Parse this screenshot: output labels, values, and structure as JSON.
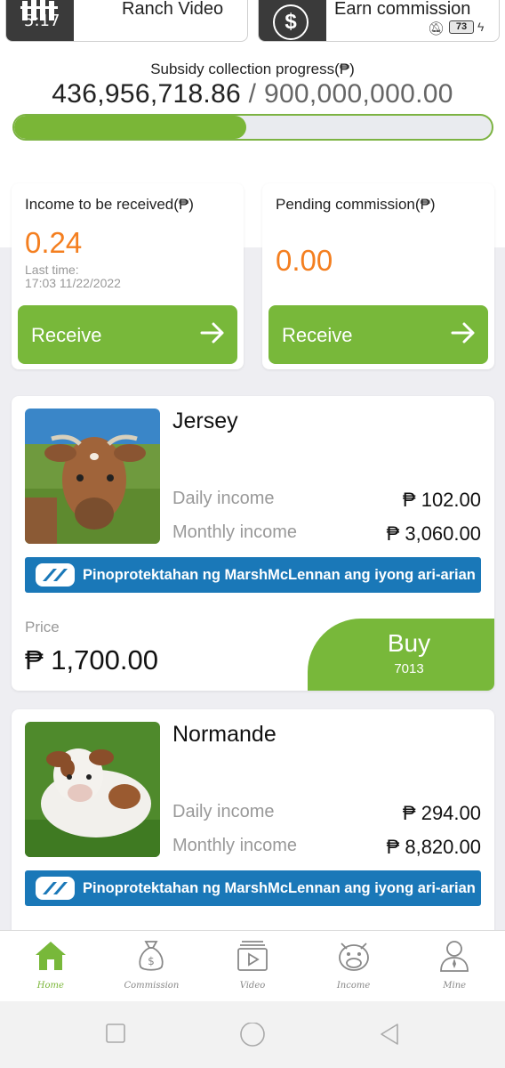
{
  "top_buttons": {
    "ranch_video": "Ranch Video",
    "earn_commission": "Earn commission"
  },
  "status_bar": {
    "time": "5:17",
    "battery": "73"
  },
  "progress": {
    "title": "Subsidy collection progress(₱)",
    "current": "436,956,718.86",
    "separator": " / ",
    "total": "900,000,000.00",
    "fraction": 0.4855
  },
  "income_cards": [
    {
      "title": "Income to be received(₱)",
      "amount": "0.24",
      "last_label": "Last time:",
      "last_time": "17:03 11/22/2022",
      "button": "Receive"
    },
    {
      "title": "Pending commission(₱)",
      "amount": "0.00",
      "button": "Receive"
    }
  ],
  "products": [
    {
      "name": "Jersey",
      "daily_label": "Daily income",
      "daily_value": "₱ 102.00",
      "monthly_label": "Monthly income",
      "monthly_value": "₱ 3,060.00",
      "banner": "Pinoprotektahan ng MarshMcLennan ang iyong ari-arian",
      "price_label": "Price",
      "price": "₱ 1,700.00",
      "buy_label": "Buy",
      "buy_count": "7013"
    },
    {
      "name": "Normande",
      "daily_label": "Daily income",
      "daily_value": "₱ 294.00",
      "monthly_label": "Monthly income",
      "monthly_value": "₱ 8,820.00",
      "banner": "Pinoprotektahan ng MarshMcLennan ang iyong ari-arian"
    }
  ],
  "nav": [
    {
      "label": "Home",
      "icon": "home-icon",
      "active": true
    },
    {
      "label": "Commission",
      "icon": "money-bag-icon",
      "active": false
    },
    {
      "label": "Video",
      "icon": "video-icon",
      "active": false
    },
    {
      "label": "Income",
      "icon": "cow-icon",
      "active": false
    },
    {
      "label": "Mine",
      "icon": "person-icon",
      "active": false
    }
  ],
  "colors": {
    "accent_green": "#78b83a",
    "amount_orange": "#f47f20",
    "banner_blue": "#1a78b8"
  }
}
